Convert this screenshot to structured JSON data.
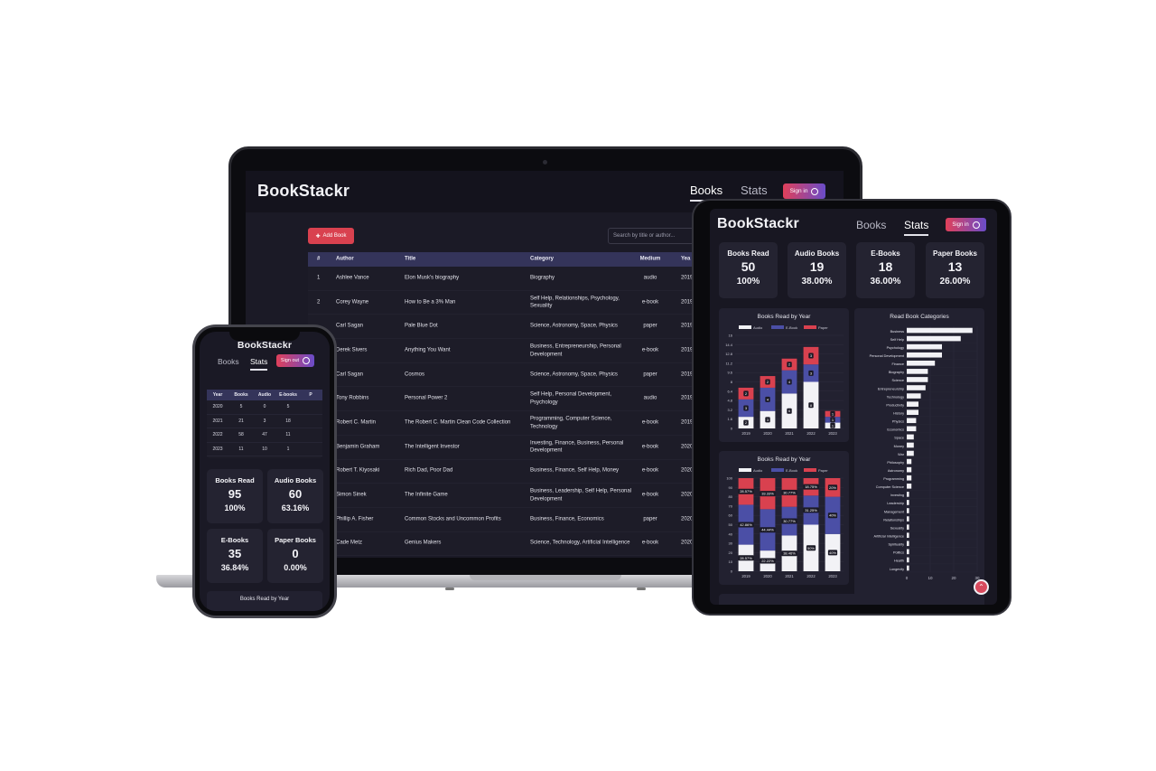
{
  "brand": "BookStackr",
  "nav": {
    "books": "Books",
    "stats": "Stats",
    "signin": "Sign in",
    "signout": "Sign out"
  },
  "laptop": {
    "add_book": "Add Book",
    "search_placeholder": "Search by title or author...",
    "columns": [
      "#",
      "Author",
      "Title",
      "Category",
      "Medium",
      "Yea"
    ],
    "rows": [
      {
        "n": "1",
        "author": "Ashlee Vance",
        "title": "Elon Musk's biography",
        "category": "Biography",
        "medium": "audio",
        "year": "2019"
      },
      {
        "n": "2",
        "author": "Corey Wayne",
        "title": "How to Be a 3% Man",
        "category": "Self Help, Relationships, Psychology, Sexuality",
        "medium": "e-book",
        "year": "2019"
      },
      {
        "n": "",
        "author": "Carl Sagan",
        "title": "Pale Blue Dot",
        "category": "Science, Astronomy, Space, Physics",
        "medium": "paper",
        "year": "2019"
      },
      {
        "n": "",
        "author": "Derek Sivers",
        "title": "Anything You Want",
        "category": "Business, Entrepreneurship, Personal Development",
        "medium": "e-book",
        "year": "2019"
      },
      {
        "n": "",
        "author": "Carl Sagan",
        "title": "Cosmos",
        "category": "Science, Astronomy, Space, Physics",
        "medium": "paper",
        "year": "2019"
      },
      {
        "n": "",
        "author": "Tony Robbins",
        "title": "Personal Power 2",
        "category": "Self Help, Personal Development, Psychology",
        "medium": "audio",
        "year": "2019"
      },
      {
        "n": "",
        "author": "Robert C. Martin",
        "title": "The Robert C. Martin Clean Code Collection",
        "category": "Programming, Computer Science, Technology",
        "medium": "e-book",
        "year": "2019"
      },
      {
        "n": "",
        "author": "Benjamin Graham",
        "title": "The Intelligent Investor",
        "category": "Investing, Finance, Business, Personal Development",
        "medium": "e-book",
        "year": "2020"
      },
      {
        "n": "",
        "author": "Robert T. Kiyosaki",
        "title": "Rich Dad, Poor Dad",
        "category": "Business, Finance, Self Help, Money",
        "medium": "e-book",
        "year": "2020"
      },
      {
        "n": "",
        "author": "Simon Sinek",
        "title": "The Infinite Game",
        "category": "Business, Leadership, Self Help, Personal Development",
        "medium": "e-book",
        "year": "2020"
      },
      {
        "n": "",
        "author": "Phillip A. Fisher",
        "title": "Common Stocks and Uncommon Profits",
        "category": "Business, Finance, Economics",
        "medium": "paper",
        "year": "2020"
      },
      {
        "n": "",
        "author": "Cade Metz",
        "title": "Genius Makers",
        "category": "Science, Technology, Artificial Intelligence",
        "medium": "e-book",
        "year": "2020"
      }
    ]
  },
  "tablet": {
    "cards": [
      {
        "title": "Books Read",
        "count": "50",
        "pct": "100%"
      },
      {
        "title": "Audio Books",
        "count": "19",
        "pct": "38.00%"
      },
      {
        "title": "E-Books",
        "count": "18",
        "pct": "36.00%"
      },
      {
        "title": "Paper Books",
        "count": "13",
        "pct": "26.00%"
      }
    ],
    "chart1_title": "Books Read by Year",
    "chart2_title": "Books Read by Year",
    "chart3_title": "Read Book Categories"
  },
  "phone": {
    "columns": [
      "Year",
      "Books",
      "Audio",
      "E-books",
      "P"
    ],
    "rows": [
      [
        "2020",
        "5",
        "0",
        "5",
        ""
      ],
      [
        "2021",
        "21",
        "3",
        "18",
        ""
      ],
      [
        "2022",
        "58",
        "47",
        "11",
        ""
      ],
      [
        "2023",
        "11",
        "10",
        "1",
        ""
      ]
    ],
    "cards": [
      {
        "title": "Books Read",
        "count": "95",
        "pct": "100%"
      },
      {
        "title": "Audio Books",
        "count": "60",
        "pct": "63.16%"
      },
      {
        "title": "E-Books",
        "count": "35",
        "pct": "36.84%"
      },
      {
        "title": "Paper Books",
        "count": "0",
        "pct": "0.00%"
      }
    ],
    "bottom_title": "Books Read by Year"
  },
  "colors": {
    "audio": "#f2f2f6",
    "ebook": "#4b4fa6",
    "paper": "#d9414f"
  },
  "chart_data": [
    {
      "type": "bar",
      "stacked": true,
      "title": "Books Read by Year",
      "categories": [
        "2019",
        "2020",
        "2021",
        "2022",
        "2023"
      ],
      "series": [
        {
          "name": "Audio",
          "values": [
            2,
            3,
            6,
            8,
            1
          ]
        },
        {
          "name": "E-Book",
          "values": [
            3,
            4,
            4,
            3,
            1
          ]
        },
        {
          "name": "Paper",
          "values": [
            2,
            2,
            2,
            3,
            1
          ]
        }
      ],
      "data_labels": [
        [
          "2",
          "3",
          "6",
          "8",
          "1"
        ],
        [
          "3",
          "4",
          "4",
          "3",
          "1"
        ],
        [
          "2",
          "2",
          "2",
          "3",
          "1"
        ]
      ],
      "yticks": [
        "0",
        "1.6",
        "3.2",
        "4.8",
        "6.4",
        "8",
        "9.6",
        "11.2",
        "12.8",
        "14.4",
        "16"
      ],
      "ylim": [
        0,
        16
      ],
      "legend": "top"
    },
    {
      "type": "bar",
      "stacked": true,
      "title": "Books Read by Year",
      "categories": [
        "2019",
        "2020",
        "2021",
        "2022",
        "2023"
      ],
      "series": [
        {
          "name": "Audio",
          "values": [
            28.57,
            22.22,
            38.46,
            50,
            40
          ]
        },
        {
          "name": "E-Book",
          "values": [
            42.86,
            44.44,
            30.77,
            31.25,
            40
          ]
        },
        {
          "name": "Paper",
          "values": [
            28.57,
            33.33,
            30.77,
            18.75,
            20
          ]
        }
      ],
      "data_labels": [
        [
          "28.57%",
          "22.22%",
          "38.46%",
          "50%",
          "40%"
        ],
        [
          "42.86%",
          "44.44%",
          "30.77%",
          "31.25%",
          "40%"
        ],
        [
          "28.57%",
          "33.33%",
          "30.77%",
          "18.75%",
          "20%"
        ]
      ],
      "yticks": [
        "0",
        "10",
        "20",
        "30",
        "40",
        "50",
        "60",
        "70",
        "80",
        "90",
        "100"
      ],
      "ylim": [
        0,
        100
      ],
      "legend": "top"
    },
    {
      "type": "bar",
      "orientation": "horizontal",
      "title": "Read Book Categories",
      "categories": [
        "Business",
        "Self Help",
        "Psychology",
        "Personal Development",
        "Finance",
        "Biography",
        "Science",
        "Entrepreneurship",
        "Technology",
        "Productivity",
        "History",
        "Physics",
        "Economics",
        "Space",
        "Money",
        "War",
        "Philosophy",
        "Astronomy",
        "Programming",
        "Computer Science",
        "Investing",
        "Leadership",
        "Management",
        "Relationships",
        "Sexuality",
        "Artificial Intelligence",
        "Spirituality",
        "Politics",
        "Health",
        "Longevity"
      ],
      "values": [
        28,
        23,
        15,
        15,
        12,
        9,
        9,
        8,
        6,
        5,
        5,
        4,
        4,
        3,
        3,
        3,
        2,
        2,
        2,
        2,
        1,
        1,
        1,
        1,
        1,
        1,
        1,
        1,
        1,
        1
      ],
      "xticks": [
        "0",
        "10",
        "20",
        "30"
      ],
      "xlim": [
        0,
        30
      ]
    }
  ]
}
